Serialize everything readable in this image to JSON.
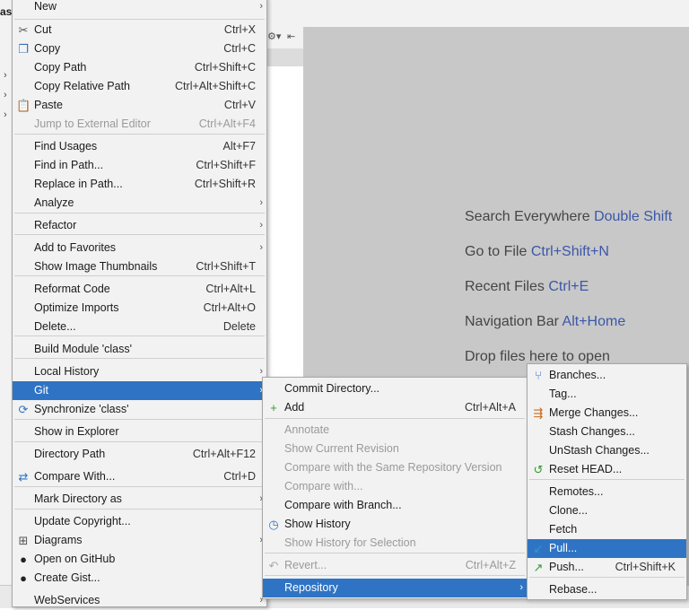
{
  "ide": {
    "left_title": "as",
    "hints": [
      {
        "text": "Search Everywhere",
        "shortcut": "Double Shift"
      },
      {
        "text": "Go to File",
        "shortcut": "Ctrl+Shift+N"
      },
      {
        "text": "Recent Files",
        "shortcut": "Ctrl+E"
      },
      {
        "text": "Navigation Bar",
        "shortcut": "Alt+Home"
      },
      {
        "text": "Drop files here to open",
        "shortcut": ""
      }
    ]
  },
  "context_menu": {
    "items": [
      {
        "label": "New",
        "shortcut": "",
        "submenu": true
      },
      {
        "label": "Cut",
        "shortcut": "Ctrl+X",
        "icon": "scissors-icon"
      },
      {
        "label": "Copy",
        "shortcut": "Ctrl+C",
        "icon": "copy-icon"
      },
      {
        "label": "Copy Path",
        "shortcut": "Ctrl+Shift+C"
      },
      {
        "label": "Copy Relative Path",
        "shortcut": "Ctrl+Alt+Shift+C"
      },
      {
        "label": "Paste",
        "shortcut": "Ctrl+V",
        "icon": "paste-icon"
      },
      {
        "label": "Jump to External Editor",
        "shortcut": "Ctrl+Alt+F4",
        "disabled": true
      },
      {
        "label": "Find Usages",
        "shortcut": "Alt+F7"
      },
      {
        "label": "Find in Path...",
        "shortcut": "Ctrl+Shift+F"
      },
      {
        "label": "Replace in Path...",
        "shortcut": "Ctrl+Shift+R"
      },
      {
        "label": "Analyze",
        "shortcut": "",
        "submenu": true
      },
      {
        "label": "Refactor",
        "shortcut": "",
        "submenu": true
      },
      {
        "label": "Add to Favorites",
        "shortcut": "",
        "submenu": true
      },
      {
        "label": "Show Image Thumbnails",
        "shortcut": "Ctrl+Shift+T"
      },
      {
        "label": "Reformat Code",
        "shortcut": "Ctrl+Alt+L"
      },
      {
        "label": "Optimize Imports",
        "shortcut": "Ctrl+Alt+O"
      },
      {
        "label": "Delete...",
        "shortcut": "Delete"
      },
      {
        "label": "Build Module 'class'",
        "shortcut": ""
      },
      {
        "label": "Local History",
        "shortcut": "",
        "submenu": true
      },
      {
        "label": "Git",
        "shortcut": "",
        "submenu": true,
        "selected": true
      },
      {
        "label": "Synchronize 'class'",
        "shortcut": "",
        "icon": "sync-icon"
      },
      {
        "label": "Show in Explorer",
        "shortcut": ""
      },
      {
        "label": "Directory Path",
        "shortcut": "Ctrl+Alt+F12"
      },
      {
        "label": "Compare With...",
        "shortcut": "Ctrl+D",
        "icon": "compare-icon"
      },
      {
        "label": "Mark Directory as",
        "shortcut": "",
        "submenu": true
      },
      {
        "label": "Update Copyright...",
        "shortcut": ""
      },
      {
        "label": "Diagrams",
        "shortcut": "",
        "submenu": true,
        "icon": "diagram-icon"
      },
      {
        "label": "Open on GitHub",
        "shortcut": "",
        "icon": "github-icon"
      },
      {
        "label": "Create Gist...",
        "shortcut": "",
        "icon": "github-icon"
      },
      {
        "label": "WebServices",
        "shortcut": "",
        "submenu": true
      }
    ]
  },
  "git_menu": {
    "items": [
      {
        "label": "Commit Directory...",
        "shortcut": ""
      },
      {
        "label": "Add",
        "shortcut": "Ctrl+Alt+A",
        "icon": "plus-icon"
      },
      {
        "label": "Annotate",
        "shortcut": "",
        "disabled": true
      },
      {
        "label": "Show Current Revision",
        "shortcut": "",
        "disabled": true
      },
      {
        "label": "Compare with the Same Repository Version",
        "shortcut": "",
        "disabled": true
      },
      {
        "label": "Compare with...",
        "shortcut": "",
        "disabled": true
      },
      {
        "label": "Compare with Branch...",
        "shortcut": ""
      },
      {
        "label": "Show History",
        "shortcut": "",
        "icon": "history-icon"
      },
      {
        "label": "Show History for Selection",
        "shortcut": "",
        "disabled": true
      },
      {
        "label": "Revert...",
        "shortcut": "Ctrl+Alt+Z",
        "disabled": true,
        "icon": "revert-icon"
      },
      {
        "label": "Repository",
        "shortcut": "",
        "submenu": true,
        "selected": true
      }
    ]
  },
  "repo_menu": {
    "items": [
      {
        "label": "Branches...",
        "shortcut": "",
        "icon": "branch-icon"
      },
      {
        "label": "Tag...",
        "shortcut": ""
      },
      {
        "label": "Merge Changes...",
        "shortcut": "",
        "icon": "merge-icon"
      },
      {
        "label": "Stash Changes...",
        "shortcut": ""
      },
      {
        "label": "UnStash Changes...",
        "shortcut": ""
      },
      {
        "label": "Reset HEAD...",
        "shortcut": "",
        "icon": "reset-icon"
      },
      {
        "label": "Remotes...",
        "shortcut": ""
      },
      {
        "label": "Clone...",
        "shortcut": ""
      },
      {
        "label": "Fetch",
        "shortcut": ""
      },
      {
        "label": "Pull...",
        "shortcut": "",
        "selected": true,
        "icon": "pull-icon"
      },
      {
        "label": "Push...",
        "shortcut": "Ctrl+Shift+K",
        "icon": "push-icon"
      },
      {
        "label": "Rebase...",
        "shortcut": ""
      }
    ]
  }
}
